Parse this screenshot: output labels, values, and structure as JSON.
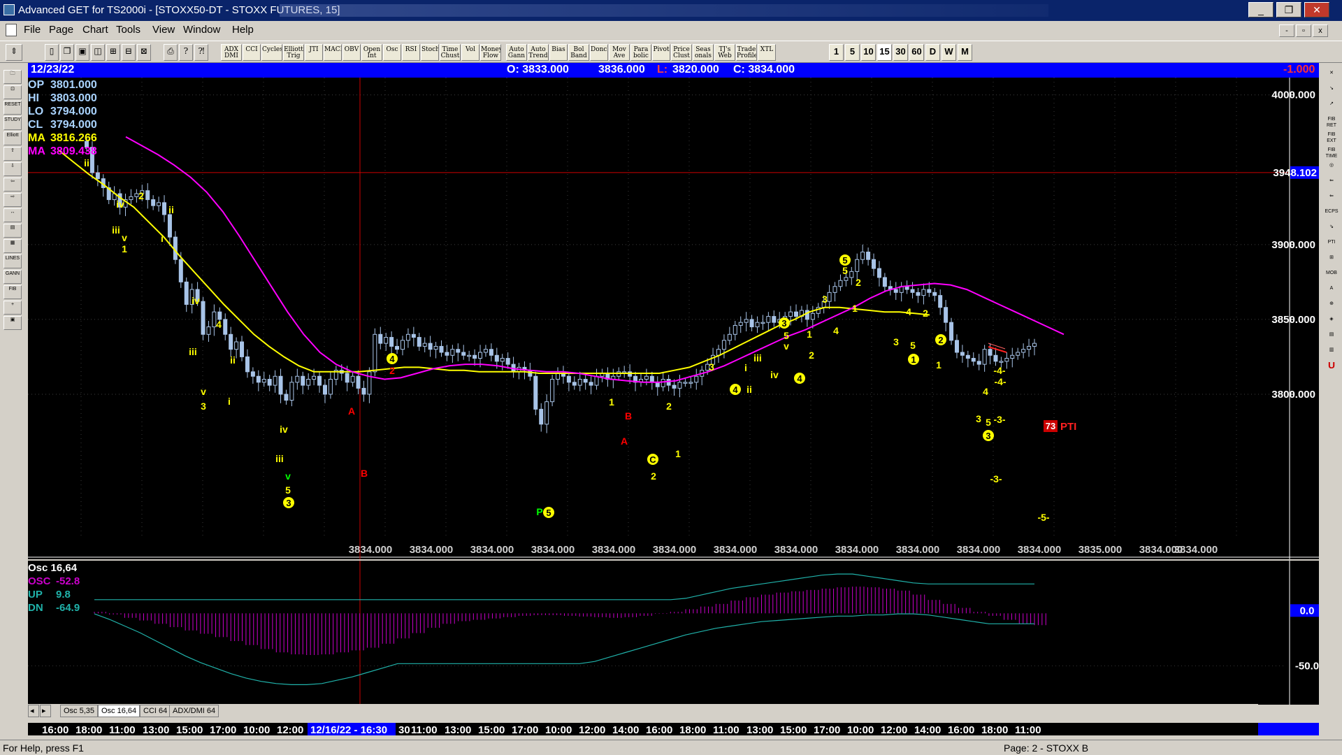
{
  "window": {
    "title": "Advanced GET for TS2000i - [STOXX50-DT - STOXX FUTURES, 15]",
    "buttons": [
      "_",
      "❐",
      "✕"
    ]
  },
  "menu": {
    "items": [
      "File",
      "Page",
      "Chart",
      "Tools",
      "View",
      "Window",
      "Help"
    ],
    "mdi_buttons": [
      "-",
      "▫",
      "x"
    ]
  },
  "toolbar": {
    "studies": [
      "ADX DMI",
      "CCI",
      "Cycles",
      "Elliott Trig",
      "JTI",
      "MACD",
      "OBV",
      "Open Int",
      "Osc",
      "RSI",
      "Stoch",
      "Time Chust",
      "Vol",
      "Money Flow",
      "Auto Gann",
      "Auto Trend",
      "Bias",
      "Bol Band",
      "Donch",
      "Mov Ave",
      "Para bolic",
      "Pivot",
      "Price Clust",
      "Seas onals",
      "TJ's Web",
      "Trade Profile",
      "XTL"
    ],
    "intervals": [
      "1",
      "5",
      "10",
      "15",
      "30",
      "60",
      "D",
      "W",
      "M"
    ],
    "active_interval": "15"
  },
  "left_tools": [
    "RESET",
    "STUDY",
    "Elliott",
    "LINES",
    "GANN",
    "FIB"
  ],
  "right_tools": [
    "FIB RET",
    "FIB EXT",
    "FIB TIME",
    "ECPS",
    "PTI",
    "MOB"
  ],
  "info_bar": {
    "date": "12/23/22",
    "open": "O: 3833.000",
    "high": "3836.000",
    "low_label": "L:",
    "low": "3820.000",
    "close": "C: 3834.000",
    "change": "-1.000"
  },
  "data_window": {
    "op": {
      "label": "OP",
      "value": "3801.000"
    },
    "hi": {
      "label": "HI",
      "value": "3803.000"
    },
    "lo": {
      "label": "LO",
      "value": "3794.000"
    },
    "cl": {
      "label": "CL",
      "value": "3794.000"
    },
    "ma1": {
      "label": "MA",
      "value": "3816.266"
    },
    "ma2": {
      "label": "MA",
      "value": "3809.438"
    }
  },
  "price_axis": {
    "labels": [
      "4000.000",
      "3900.000",
      "3850.000",
      "3800.000"
    ],
    "cursor_price": "3948.102",
    "y_range": [
      3750,
      4005
    ]
  },
  "bottom_price_labels": [
    "3834.000",
    "3834.000",
    "3834.000",
    "3834.000",
    "3834.000",
    "3834.000",
    "3834.000",
    "3834.000",
    "3834.000",
    "3834.000",
    "3834.000",
    "3834.000",
    "3835.000",
    "3834.000",
    "3834.000"
  ],
  "chart_data": {
    "type": "candlestick",
    "y_range": [
      3750,
      4005
    ],
    "ticks": [
      3800,
      3850,
      3900,
      4000
    ],
    "close_series": [
      3965,
      3948,
      3944,
      3938,
      3930,
      3934,
      3925,
      3930,
      3932,
      3934,
      3936,
      3930,
      3926,
      3928,
      3920,
      3905,
      3890,
      3875,
      3860,
      3870,
      3862,
      3840,
      3845,
      3855,
      3850,
      3840,
      3830,
      3835,
      3825,
      3815,
      3812,
      3808,
      3810,
      3806,
      3812,
      3800,
      3796,
      3808,
      3812,
      3806,
      3810,
      3812,
      3806,
      3800,
      3810,
      3816,
      3814,
      3808,
      3812,
      3804,
      3800,
      3815,
      3840,
      3834,
      3838,
      3832,
      3830,
      3836,
      3840,
      3838,
      3832,
      3834,
      3830,
      3832,
      3828,
      3826,
      3830,
      3828,
      3826,
      3826,
      3824,
      3828,
      3830,
      3826,
      3822,
      3824,
      3820,
      3815,
      3818,
      3816,
      3812,
      3790,
      3780,
      3795,
      3810,
      3814,
      3812,
      3808,
      3806,
      3810,
      3808,
      3806,
      3812,
      3814,
      3810,
      3812,
      3815,
      3815,
      3812,
      3808,
      3810,
      3812,
      3808,
      3805,
      3810,
      3806,
      3804,
      3808,
      3808,
      3808,
      3812,
      3816,
      3820,
      3826,
      3830,
      3836,
      3840,
      3846,
      3848,
      3850,
      3845,
      3848,
      3848,
      3852,
      3848,
      3850,
      3852,
      3855,
      3852,
      3856,
      3850,
      3854,
      3858,
      3862,
      3868,
      3872,
      3876,
      3878,
      3882,
      3890,
      3895,
      3890,
      3884,
      3878,
      3872,
      3870,
      3868,
      3872,
      3870,
      3868,
      3866,
      3870,
      3868,
      3866,
      3858,
      3848,
      3836,
      3828,
      3826,
      3824,
      3822,
      3820,
      3830,
      3826,
      3822,
      3822,
      3824,
      3826,
      3828,
      3830,
      3832,
      3834
    ],
    "series": [
      {
        "name": "MA 3816.266",
        "color": "#ffff00",
        "values": [
          3963,
          3955,
          3947,
          3940,
          3932,
          3925,
          3915,
          3905,
          3893,
          3882,
          3871,
          3860,
          3850,
          3840,
          3832,
          3825,
          3819,
          3815,
          3815,
          3815,
          3815,
          3816,
          3817,
          3818,
          3818,
          3817,
          3816,
          3816,
          3815,
          3815,
          3815,
          3815,
          3814,
          3814,
          3814,
          3814,
          3814,
          3814,
          3814,
          3814,
          3814,
          3816,
          3818,
          3822,
          3826,
          3831,
          3836,
          3841,
          3846,
          3850,
          3855,
          3858,
          3858,
          3857,
          3856,
          3855,
          3855,
          3854,
          3853
        ]
      },
      {
        "name": "MA 3809.438",
        "color": "#ff00ff",
        "values": [
          3972,
          3966,
          3960,
          3953,
          3945,
          3935,
          3922,
          3906,
          3889,
          3872,
          3855,
          3840,
          3828,
          3820,
          3815,
          3812,
          3810,
          3811,
          3814,
          3817,
          3819,
          3820,
          3820,
          3819,
          3817,
          3816,
          3815,
          3815,
          3814,
          3812,
          3810,
          3809,
          3808,
          3808,
          3809,
          3812,
          3815,
          3819,
          3824,
          3829,
          3834,
          3839,
          3843,
          3848,
          3853,
          3858,
          3864,
          3869,
          3872,
          3873,
          3874,
          3873,
          3870,
          3865,
          3860,
          3855,
          3850,
          3845,
          3840
        ]
      }
    ]
  },
  "wave_labels": [
    {
      "text": "ii",
      "color": "#ffff00"
    },
    {
      "text": "iv",
      "color": "#ffff00"
    },
    {
      "text": "2",
      "color": "#ffff00"
    },
    {
      "text": "ii",
      "color": "#ffff00"
    },
    {
      "text": "iii",
      "color": "#ffff00"
    },
    {
      "text": "v",
      "color": "#ffff00"
    },
    {
      "text": "1",
      "color": "#ffff00"
    },
    {
      "text": "i",
      "color": "#ffff00"
    },
    {
      "text": "iv",
      "color": "#ffff00"
    },
    {
      "text": "iii",
      "color": "#ffff00"
    },
    {
      "text": "4",
      "color": "#ffff00"
    },
    {
      "text": "ii",
      "color": "#ffff00"
    },
    {
      "text": "v",
      "color": "#ffff00"
    },
    {
      "text": "3",
      "color": "#ffff00"
    },
    {
      "text": "i",
      "color": "#ffff00"
    },
    {
      "text": "iv",
      "color": "#ffff00"
    },
    {
      "text": "iii",
      "color": "#ffff00"
    },
    {
      "text": "v",
      "color": "#00ff00"
    },
    {
      "text": "5",
      "color": "#ffff00"
    },
    {
      "text": "3",
      "color": "#ffff00"
    },
    {
      "text": "A",
      "color": "#ff0000"
    },
    {
      "text": "B",
      "color": "#ff0000"
    },
    {
      "text": "4",
      "color": "#ffff00"
    },
    {
      "text": "2",
      "color": "#ff0000"
    },
    {
      "text": "P",
      "color": "#00ff00"
    },
    {
      "text": "5",
      "color": "#ffff00"
    },
    {
      "text": "1",
      "color": "#ffff00"
    },
    {
      "text": "B",
      "color": "#ff0000"
    },
    {
      "text": "A",
      "color": "#ff0000"
    },
    {
      "text": "C",
      "color": "#ff0000"
    },
    {
      "text": "2",
      "color": "#ffff00"
    },
    {
      "text": "1",
      "color": "#ffff00"
    },
    {
      "text": "2",
      "color": "#ffff00"
    },
    {
      "text": "3",
      "color": "#ffff00"
    },
    {
      "text": "4",
      "color": "#ffff00"
    },
    {
      "text": "ii",
      "color": "#ffff00"
    },
    {
      "text": "i",
      "color": "#ffff00"
    },
    {
      "text": "iii",
      "color": "#ffff00"
    },
    {
      "text": "iv",
      "color": "#ffff00"
    },
    {
      "text": "3",
      "color": "#ffff00"
    },
    {
      "text": "5",
      "color": "#ffff00"
    },
    {
      "text": "v",
      "color": "#ffff00"
    },
    {
      "text": "4",
      "color": "#ffff00"
    },
    {
      "text": "1",
      "color": "#ffff00"
    },
    {
      "text": "2",
      "color": "#ffff00"
    },
    {
      "text": "3",
      "color": "#ffff00"
    },
    {
      "text": "4",
      "color": "#ffff00"
    },
    {
      "text": "5",
      "color": "#ffff00"
    },
    {
      "text": "5",
      "color": "#ffff00"
    },
    {
      "text": "2",
      "color": "#ffff00"
    },
    {
      "text": "1",
      "color": "#ffff00"
    },
    {
      "text": "4",
      "color": "#ffff00"
    },
    {
      "text": "2",
      "color": "#ffff00"
    },
    {
      "text": "3",
      "color": "#ffff00"
    },
    {
      "text": "5",
      "color": "#ffff00"
    },
    {
      "text": "1",
      "color": "#ffff00"
    },
    {
      "text": "2",
      "color": "#ffff00"
    },
    {
      "text": "1",
      "color": "#ffff00"
    },
    {
      "text": "-4-",
      "color": "#ffff00"
    },
    {
      "text": "-4-",
      "color": "#ffff00"
    },
    {
      "text": "4",
      "color": "#ffff00"
    },
    {
      "text": "3",
      "color": "#ffff00"
    },
    {
      "text": "5",
      "color": "#ffff00"
    },
    {
      "text": "-3-",
      "color": "#ffff00"
    },
    {
      "text": "3",
      "color": "#ffff00"
    },
    {
      "text": "-3-",
      "color": "#ffff00"
    },
    {
      "text": "-5-",
      "color": "#ffff00"
    }
  ],
  "pti": {
    "value": "73",
    "label": "PTI"
  },
  "osc": {
    "title": "Osc 16,64",
    "osc": {
      "label": "OSC",
      "value": "-52.8"
    },
    "up": {
      "label": "UP",
      "value": "9.8"
    },
    "dn": {
      "label": "DN",
      "value": "-64.9"
    },
    "axis_labels": [
      "0.0",
      "-50.0"
    ],
    "histogram": [
      -2,
      -6,
      -11,
      -15,
      -20,
      -25,
      -30,
      -35,
      -40,
      -46,
      -52,
      -58,
      -63,
      -66,
      -67,
      -66,
      -63,
      -60,
      -56,
      -50,
      -42,
      -34,
      -26,
      -20,
      -16,
      -14,
      -12,
      -10,
      -8,
      -7,
      -7,
      -8,
      -9,
      -10,
      -11,
      -10,
      -8,
      -5,
      -2,
      2,
      6,
      10,
      15,
      20,
      24,
      27,
      29,
      31,
      33,
      35,
      36,
      35,
      33,
      30,
      24,
      16,
      10,
      4,
      -2,
      -8,
      -14,
      -20,
      -22
    ],
    "up_line": [
      9.8,
      9.8,
      9.8,
      9.8,
      9.8,
      9.8,
      9.8,
      9.8,
      9.8,
      9.8,
      9.8,
      9.8,
      9.8,
      9.8,
      9.8,
      9.8,
      9.8,
      9.8,
      9.8,
      9.8,
      9.8,
      9.8,
      9.8,
      9.8,
      9.8,
      9.8,
      9.8,
      9.8,
      9.8,
      9.8,
      9.8,
      9.8,
      9.8,
      9.8,
      9.8,
      9.8,
      9.8,
      9.8,
      9.8,
      11,
      14,
      17,
      20,
      22,
      24,
      26,
      28,
      30,
      32,
      33,
      33,
      31,
      29,
      27,
      25,
      24,
      24,
      24,
      24,
      24,
      24,
      24,
      24
    ],
    "dn_line": [
      -3,
      -8,
      -14,
      -20,
      -27,
      -34,
      -41,
      -47,
      -52,
      -57,
      -61,
      -64,
      -66,
      -67,
      -67,
      -66,
      -63,
      -60,
      -56,
      -52,
      -48,
      -48,
      -48,
      -48,
      -48,
      -48,
      -48,
      -48,
      -48,
      -48,
      -48,
      -48,
      -48,
      -46,
      -42,
      -38,
      -34,
      -30,
      -26,
      -22,
      -19,
      -16,
      -14,
      -12,
      -10,
      -9,
      -8,
      -7,
      -6,
      -5,
      -5,
      -4,
      -4,
      -3,
      -3,
      -4,
      -6,
      -8,
      -10,
      -12,
      -12,
      -12,
      -12
    ]
  },
  "tabs": [
    "Osc 5,35",
    "Osc 16,64",
    "CCI 64",
    "ADX/DMI 64"
  ],
  "active_tab": "Osc 16,64",
  "time_axis": {
    "labels": [
      "16:00",
      "18:00",
      "11:00",
      "13:00",
      "15:00",
      "17:00",
      "10:00",
      "12:00",
      "12/16/22 - 16:30",
      "30",
      "11:00",
      "13:00",
      "15:00",
      "17:00",
      "10:00",
      "12:00",
      "14:00",
      "16:00",
      "18:00",
      "11:00",
      "13:00",
      "15:00",
      "17:00",
      "10:00",
      "12:00",
      "14:00",
      "16:00",
      "18:00",
      "11:00"
    ],
    "highlight": "12/16/22 - 16:30"
  },
  "status": {
    "help": "For Help, press F1",
    "page": "Page: 2 - STOXX B"
  },
  "colors": {
    "bar": "#a8c4e8",
    "ma1": "#ffff00",
    "ma2": "#ff00ff",
    "osc_hist": "#cc00cc",
    "up_line": "#20b2aa",
    "dn_line": "#20b2aa",
    "cursor": "#cc0000",
    "axis_highlight": "#0000ff"
  }
}
